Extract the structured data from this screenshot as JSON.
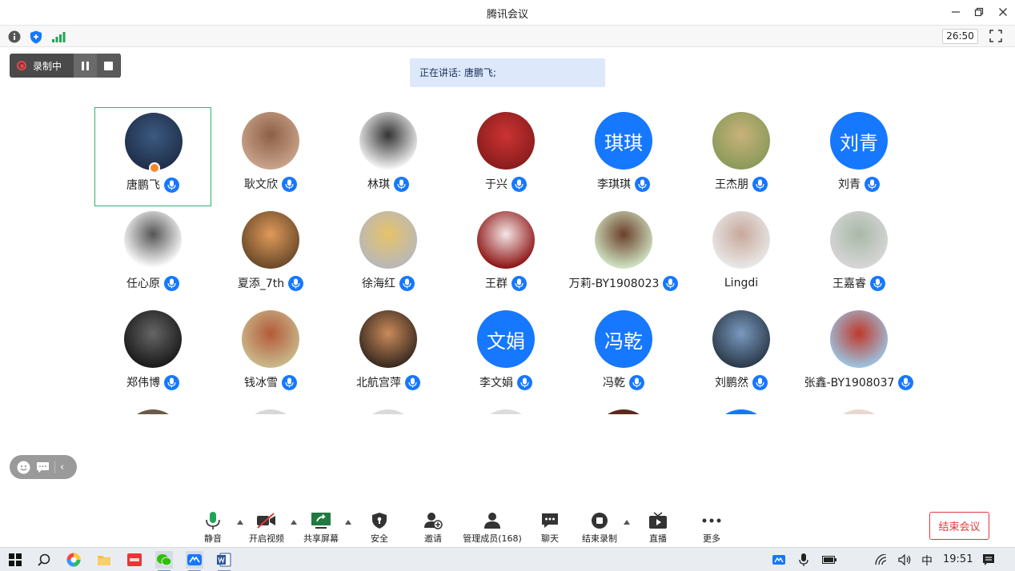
{
  "window": {
    "title": "腾讯会议",
    "controls": [
      "minimize",
      "restore",
      "close"
    ]
  },
  "info_bar": {
    "icons": [
      "info-icon",
      "shield-icon",
      "signal-icon"
    ],
    "timer": "26:50"
  },
  "recording": {
    "label": "录制中"
  },
  "speaking": {
    "text": "正在讲话: 唐鹏飞;"
  },
  "participants": [
    {
      "name": "唐鹏飞",
      "avatar": "photo",
      "host": true,
      "active": true
    },
    {
      "name": "耿文欣",
      "avatar": "photo"
    },
    {
      "name": "林琪",
      "avatar": "photo"
    },
    {
      "name": "于兴",
      "avatar": "photo"
    },
    {
      "name": "李琪琪",
      "avatar_text": "琪琪"
    },
    {
      "name": "王杰朋",
      "avatar": "photo"
    },
    {
      "name": "刘青",
      "avatar_text": "刘青"
    },
    {
      "name": "任心原",
      "avatar": "photo"
    },
    {
      "name": "夏添_7th",
      "avatar": "photo"
    },
    {
      "name": "徐海红",
      "avatar": "photo"
    },
    {
      "name": "王群",
      "avatar": "photo"
    },
    {
      "name": "万莉-BY1908023",
      "avatar": "photo"
    },
    {
      "name": "Lingdi",
      "avatar": "photo",
      "no_mic": true
    },
    {
      "name": "王嘉睿",
      "avatar": "photo"
    },
    {
      "name": "郑伟博",
      "avatar": "photo"
    },
    {
      "name": "钱冰雪",
      "avatar": "photo"
    },
    {
      "name": "北航宫萍",
      "avatar": "photo"
    },
    {
      "name": "李文娟",
      "avatar_text": "文娟"
    },
    {
      "name": "冯乾",
      "avatar_text": "冯乾"
    },
    {
      "name": "刘鹏然",
      "avatar": "photo"
    },
    {
      "name": "张鑫-BY1908037",
      "avatar": "photo"
    }
  ],
  "toolbar": {
    "mute": "静音",
    "video": "开启视频",
    "share": "共享屏幕",
    "security": "安全",
    "invite": "邀请",
    "members": "管理成员(168)",
    "chat": "聊天",
    "end_record": "结束录制",
    "live": "直播",
    "more": "更多",
    "end_meeting": "结束会议"
  },
  "taskbar": {
    "ime": "中",
    "clock": "19:51"
  },
  "colors": {
    "accent": "#1677ff",
    "active_border": "#2db36f",
    "danger": "#e03a3a",
    "speaking_bg": "#dde9fb"
  }
}
